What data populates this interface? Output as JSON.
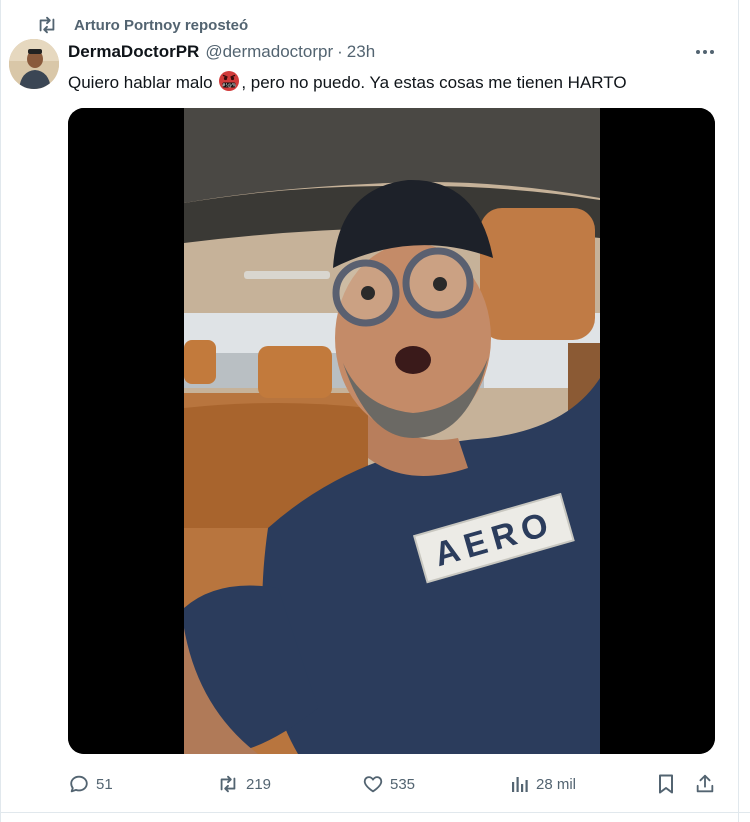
{
  "repost": {
    "label": "Arturo Portnoy reposteó",
    "icon": "repost-icon"
  },
  "author": {
    "name": "DermaDoctorPR",
    "handle": "@dermadoctorpr",
    "separator": "·",
    "time": "23h"
  },
  "tweet": {
    "text_before": "Quiero hablar malo ",
    "emoji": "face-with-symbols-on-mouth",
    "text_after": ", pero no puedo. Ya estas cosas me tienen HARTO"
  },
  "media": {
    "type": "video",
    "shirt_text": "AERO"
  },
  "actions": {
    "replies": "51",
    "reposts": "219",
    "likes": "535",
    "views": "28 mil"
  },
  "colors": {
    "text": "#0f1419",
    "muted": "#536471",
    "border": "#e1e8ed"
  }
}
